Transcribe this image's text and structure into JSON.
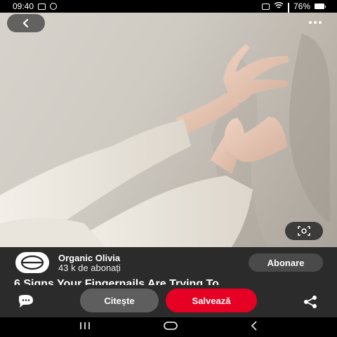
{
  "status_bar": {
    "time": "09:40",
    "battery": "76%",
    "left_icons": [
      "gallery-icon",
      "message-icon",
      "whatsapp-icon"
    ],
    "right_icons": [
      "screenshot-icon",
      "wifi-icon",
      "signal-icon",
      "battery-icon"
    ]
  },
  "pin": {
    "image_description_icons": [
      "back-icon",
      "more-icon",
      "visual-search-icon"
    ],
    "creator": {
      "name": "Organic Olivia",
      "followers": "43 k de abonați",
      "follow_label": "Abonare"
    },
    "title": "6 Signs Your Fingernails Are Trying To"
  },
  "actions": {
    "read_label": "Citește",
    "save_label": "Salvează",
    "colors": {
      "save": "#e60023",
      "read": "#5e5e5e"
    }
  },
  "nav": {
    "icons": [
      "recents-icon",
      "home-icon",
      "back-nav-icon"
    ]
  }
}
